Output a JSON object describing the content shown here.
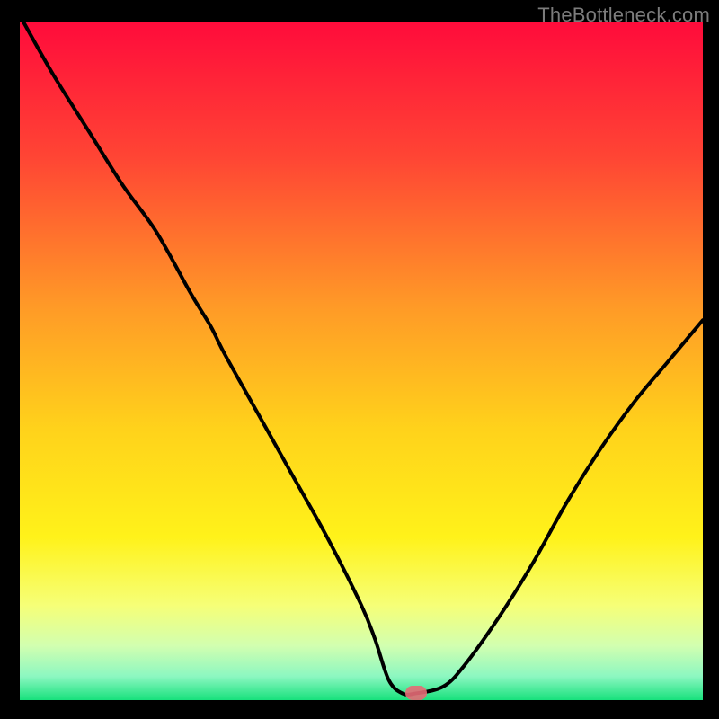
{
  "watermark": {
    "text": "TheBottleneck.com"
  },
  "chart_data": {
    "type": "line",
    "title": "",
    "xlabel": "",
    "ylabel": "",
    "xlim": [
      0,
      100
    ],
    "ylim": [
      0,
      100
    ],
    "series": [
      {
        "name": "bottleneck-curve",
        "x": [
          0.5,
          5,
          10,
          15,
          20,
          25,
          28,
          30,
          35,
          40,
          45,
          50,
          52,
          54,
          56,
          58,
          62,
          65,
          70,
          75,
          80,
          85,
          90,
          95,
          100
        ],
        "values": [
          100,
          92,
          84,
          76,
          69,
          60,
          55,
          51,
          42,
          33,
          24,
          14,
          9,
          3,
          1,
          1,
          2,
          5,
          12,
          20,
          29,
          37,
          44,
          50,
          56
        ]
      }
    ],
    "marker": {
      "x": 58,
      "y": 1
    },
    "gradient_stops": [
      {
        "offset": 0,
        "color": "#ff0b3b"
      },
      {
        "offset": 0.2,
        "color": "#ff4534"
      },
      {
        "offset": 0.42,
        "color": "#ff9a27"
      },
      {
        "offset": 0.6,
        "color": "#ffd21b"
      },
      {
        "offset": 0.76,
        "color": "#fff21a"
      },
      {
        "offset": 0.86,
        "color": "#f6ff77"
      },
      {
        "offset": 0.92,
        "color": "#d2ffb0"
      },
      {
        "offset": 0.965,
        "color": "#8cf7c1"
      },
      {
        "offset": 1.0,
        "color": "#17e17c"
      }
    ]
  }
}
